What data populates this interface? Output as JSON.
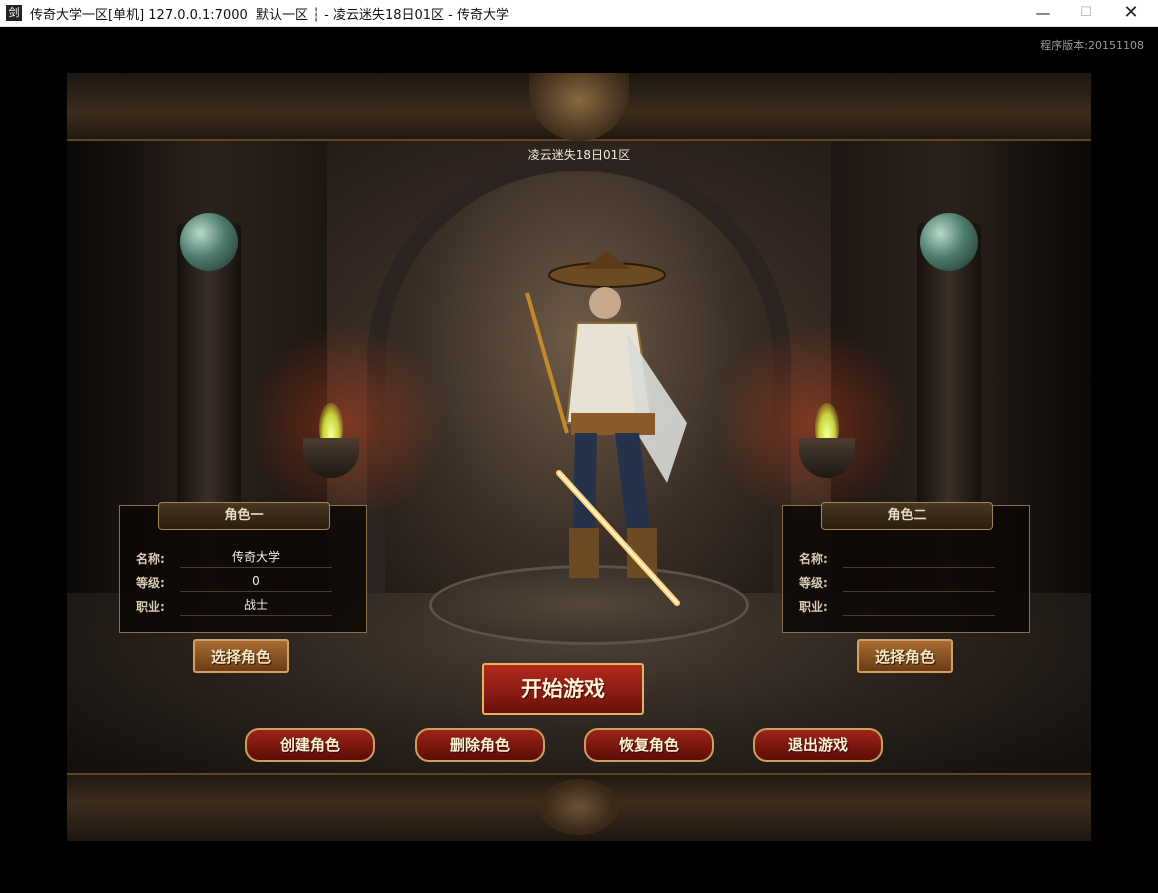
{
  "window": {
    "icon_glyph": "剑",
    "title": "传奇大学一区[单机] 127.0.0.1:7000  默认一区 ┆ - 凌云迷失18日01区 - 传奇大学",
    "minimize": "—",
    "maximize": "☐",
    "close": "✕"
  },
  "version_text": "程序版本:20151108",
  "server_name": "凌云迷失18日01区",
  "role_one": {
    "title": "角色一",
    "name_label": "名称:",
    "name_value": "传奇大学",
    "level_label": "等级:",
    "level_value": "0",
    "class_label": "职业:",
    "class_value": "战士",
    "select_button": "选择角色"
  },
  "role_two": {
    "title": "角色二",
    "name_label": "名称:",
    "name_value": "",
    "level_label": "等级:",
    "level_value": "",
    "class_label": "职业:",
    "class_value": "",
    "select_button": "选择角色"
  },
  "buttons": {
    "start_game": "开始游戏",
    "create_role": "创建角色",
    "delete_role": "删除角色",
    "restore_role": "恢复角色",
    "exit_game": "退出游戏"
  },
  "icons": [
    "sword-app-icon",
    "brazier-flame-icon",
    "jade-orb-icon",
    "dragon-emblem-icon"
  ]
}
